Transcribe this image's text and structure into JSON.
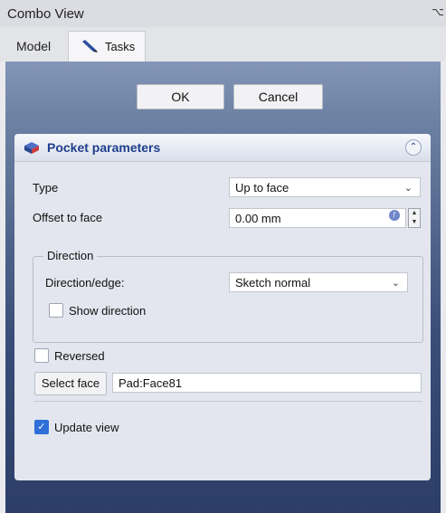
{
  "window": {
    "title": "Combo View",
    "pin_icon": "pin-icon"
  },
  "tabs": [
    {
      "label": "Model"
    },
    {
      "label": "Tasks",
      "icon": "pencil-icon"
    }
  ],
  "buttons": {
    "ok": "OK",
    "cancel": "Cancel"
  },
  "task": {
    "title": "Pocket parameters",
    "type_label": "Type",
    "type_value": "Up to face",
    "offset_label": "Offset to face",
    "offset_value": "0.00 mm",
    "direction": {
      "group_title": "Direction",
      "edge_label": "Direction/edge:",
      "edge_value": "Sketch normal",
      "show_direction_label": "Show direction",
      "show_direction_checked": false
    },
    "reversed_label": "Reversed",
    "reversed_checked": false,
    "select_face_label": "Select face",
    "face_value": "Pad:Face81",
    "update_view_label": "Update view",
    "update_view_checked": true
  },
  "colors": {
    "accent": "#1f3f8c",
    "checkbox": "#2e6fd8",
    "panel_top": "#8396b6",
    "panel_bottom": "#2c3e68"
  }
}
